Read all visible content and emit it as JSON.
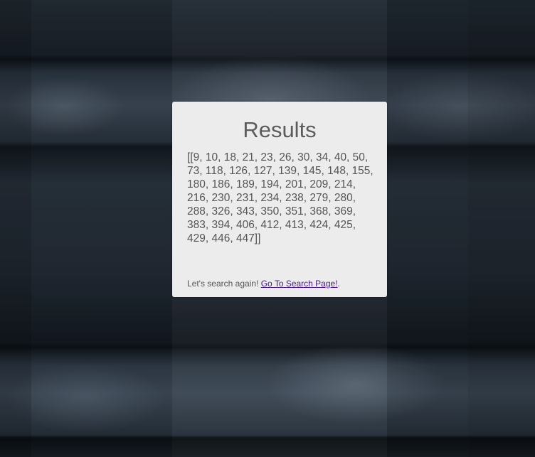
{
  "card": {
    "title": "Results",
    "results": "[[9, 10, 18, 21, 23, 26, 30, 34, 40, 50, 73, 118, 126, 127, 139, 145, 148, 155, 180, 186, 189, 194, 201, 209, 214, 216, 230, 231, 234, 238, 279, 280, 288, 326, 343, 350, 351, 368, 369, 383, 394, 406, 412, 413, 424, 425, 429, 446, 447]]",
    "footer_prefix": "Let's search again! ",
    "link_label": "Go To Search Page!",
    "footer_suffix": "."
  },
  "colors": {
    "card_background": "#ececec",
    "text": "#555555",
    "link": "#4b1a83"
  }
}
